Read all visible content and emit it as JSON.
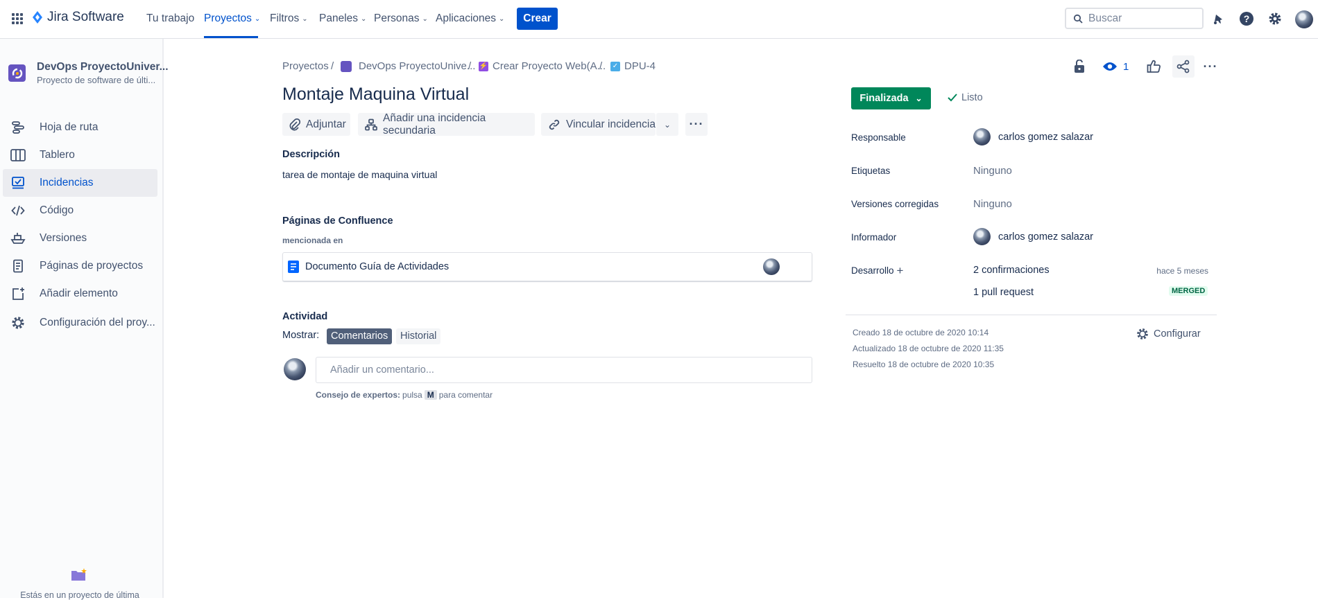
{
  "topbar": {
    "product": "Jira Software",
    "nav": [
      {
        "label": "Tu trabajo"
      },
      {
        "label": "Proyectos"
      },
      {
        "label": "Filtros"
      },
      {
        "label": "Paneles"
      },
      {
        "label": "Personas"
      },
      {
        "label": "Aplicaciones"
      }
    ],
    "create_label": "Crear",
    "search_placeholder": "Buscar"
  },
  "sidebar": {
    "project_name": "DevOps ProyectoUniver...",
    "project_type": "Proyecto de software de últi...",
    "items": [
      {
        "label": "Hoja de ruta",
        "icon": "roadmap-icon"
      },
      {
        "label": "Tablero",
        "icon": "board-icon"
      },
      {
        "label": "Incidencias",
        "icon": "issues-icon"
      },
      {
        "label": "Código",
        "icon": "code-icon"
      },
      {
        "label": "Versiones",
        "icon": "ship-icon"
      },
      {
        "label": "Páginas de proyectos",
        "icon": "page-icon"
      },
      {
        "label": "Añadir elemento",
        "icon": "add-item-icon"
      },
      {
        "label": "Configuración del proy...",
        "icon": "gear-icon"
      }
    ],
    "footer_text": "Estás en un proyecto de última"
  },
  "breadcrumb": {
    "projects": "Proyectos",
    "project": "DevOps ProyectoUnive...",
    "epic": "Crear Proyecto Web(A...",
    "issue_key": "DPU-4"
  },
  "issue": {
    "title": "Montaje Maquina Virtual",
    "actions": {
      "attach": "Adjuntar",
      "add_child": "Añadir una incidencia secundaria",
      "link": "Vincular incidencia"
    },
    "description_heading": "Descripción",
    "description": "tarea de montaje de maquina virtual",
    "confluence_heading": "Páginas de Confluence",
    "mentioned_in": "mencionada en",
    "confluence_page": "Documento Guía de Actividades",
    "activity": {
      "heading": "Actividad",
      "show_label": "Mostrar:",
      "tab_comments": "Comentarios",
      "tab_history": "Historial",
      "comment_placeholder": "Añadir un comentario...",
      "tip_bold": "Consejo de expertos:",
      "tip_press": "pulsa",
      "tip_key": "M",
      "tip_rest": "para comentar"
    }
  },
  "right_panel": {
    "watch_count": "1",
    "status": "Finalizada",
    "resolution": "Listo",
    "fields": {
      "assignee_label": "Responsable",
      "assignee": "carlos gomez salazar",
      "labels_label": "Etiquetas",
      "labels": "Ninguno",
      "fix_versions_label": "Versiones corregidas",
      "fix_versions": "Ninguno",
      "reporter_label": "Informador",
      "reporter": "carlos gomez salazar",
      "development_label": "Desarrollo",
      "commits": "2 confirmaciones",
      "commits_time": "hace 5 meses",
      "pull_requests": "1 pull request",
      "pr_status": "MERGED"
    },
    "created": "Creado 18 de octubre de 2020 10:14",
    "updated": "Actualizado 18 de octubre de 2020 11:35",
    "resolved": "Resuelto 18 de octubre de 2020 10:35",
    "configure": "Configurar"
  },
  "colors": {
    "brand_blue": "#0052cc",
    "status_green": "#00875a",
    "text_dark": "#172b4d",
    "text_subtle": "#5e6c84"
  }
}
